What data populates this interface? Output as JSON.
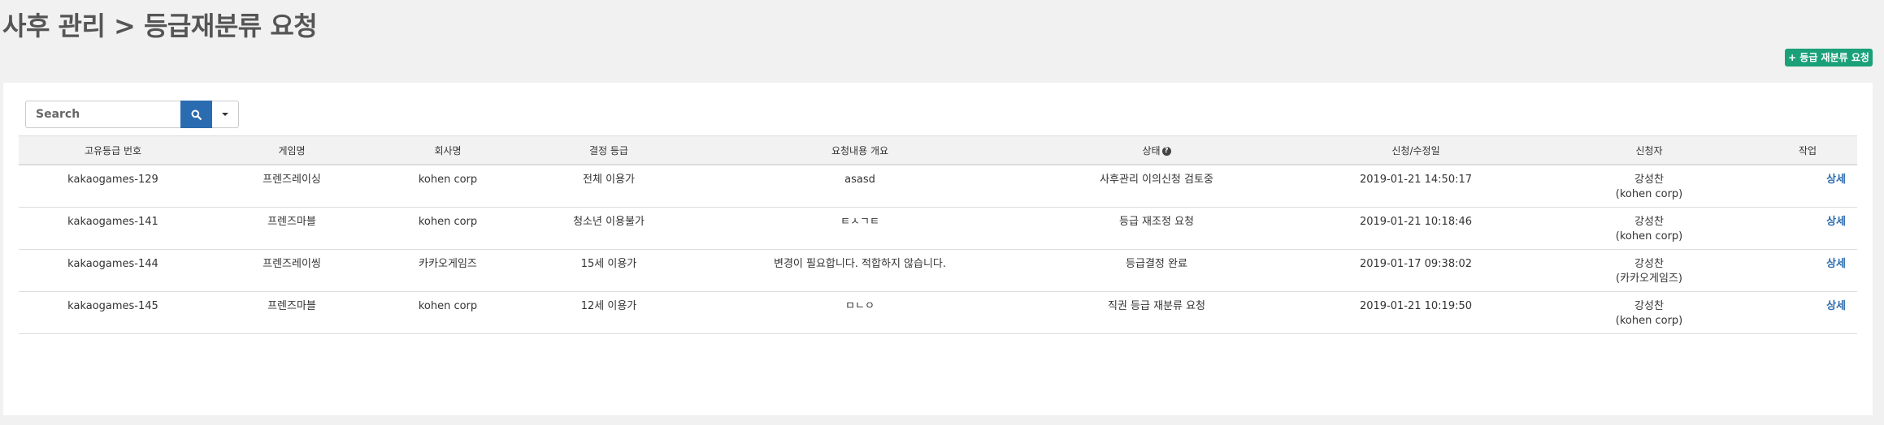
{
  "page": {
    "title": "사후 관리 > 등급재분류 요청",
    "add_button_label": "+ 등급 재분류 요청"
  },
  "search": {
    "placeholder": "Search",
    "value": "",
    "search_icon": "search-icon",
    "dropdown_icon": "caret-down-icon"
  },
  "table": {
    "columns": [
      "고유등급 번호",
      "게임명",
      "회사명",
      "결정 등급",
      "요청내용 개요",
      "상태",
      "신청/수정일",
      "신청자",
      "작업"
    ],
    "status_help_icon": "?",
    "rows": [
      {
        "id": "kakaogames-129",
        "game": "프렌즈레이싱",
        "company": "kohen corp",
        "rating": "전체 이용가",
        "summary": "asasd",
        "status": "사후관리 이의신청 검토중",
        "date": "2019-01-21 14:50:17",
        "applicant": "강성찬",
        "applicant_company": "(kohen corp)",
        "action": "상세"
      },
      {
        "id": "kakaogames-141",
        "game": "프렌즈마블",
        "company": "kohen corp",
        "rating": "청소년 이용불가",
        "summary": "ㅌㅅㄱㅌ",
        "status": "등급 재조정 요청",
        "date": "2019-01-21 10:18:46",
        "applicant": "강성찬",
        "applicant_company": "(kohen corp)",
        "action": "상세"
      },
      {
        "id": "kakaogames-144",
        "game": "프렌즈레이씽",
        "company": "카카오게임즈",
        "rating": "15세 이용가",
        "summary": "변경이 필요합니다. 적합하지 않습니다.",
        "status": "등급결정 완료",
        "date": "2019-01-17 09:38:02",
        "applicant": "강성찬",
        "applicant_company": "(카카오게임즈)",
        "action": "상세"
      },
      {
        "id": "kakaogames-145",
        "game": "프렌즈마블",
        "company": "kohen corp",
        "rating": "12세 이용가",
        "summary": "ㅁㄴㅇ",
        "status": "직권 등급 재분류 요청",
        "date": "2019-01-21 10:19:50",
        "applicant": "강성찬",
        "applicant_company": "(kohen corp)",
        "action": "상세"
      }
    ]
  },
  "colors": {
    "background": "#f1f1f1",
    "accent_green": "#1aa179",
    "accent_blue": "#2b6cb0"
  }
}
